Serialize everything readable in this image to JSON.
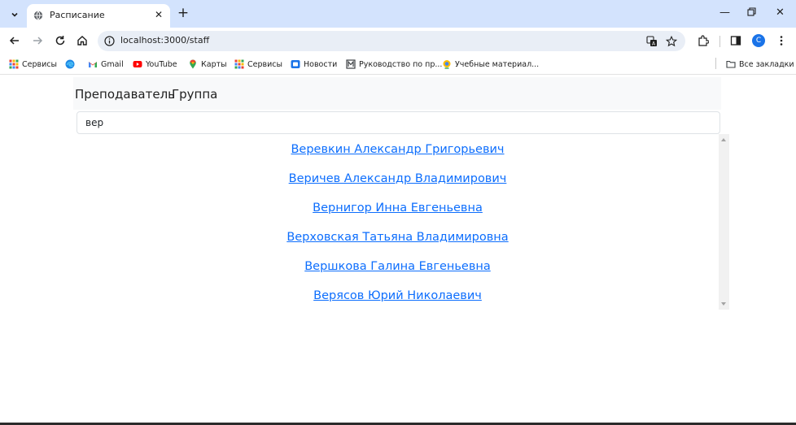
{
  "browser": {
    "tab_title": "Расписание",
    "url": "localhost:3000/staff",
    "profile_initial": "C"
  },
  "bookmarks": [
    {
      "label": "Сервисы",
      "icon": "apps-grid-icon"
    },
    {
      "label": "",
      "icon": "edge-icon"
    },
    {
      "label": "Gmail",
      "icon": "gmail-icon"
    },
    {
      "label": "YouTube",
      "icon": "youtube-icon"
    },
    {
      "label": "Карты",
      "icon": "maps-pin-icon"
    },
    {
      "label": "Сервисы",
      "icon": "apps-grid-icon"
    },
    {
      "label": "Новости",
      "icon": "news-icon"
    },
    {
      "label": "Руководство по пр...",
      "icon": "guide-icon"
    },
    {
      "label": "Учебные материал...",
      "icon": "materials-icon"
    }
  ],
  "all_bookmarks_label": "Все закладки",
  "page": {
    "nav": {
      "teacher": "Преподаватель",
      "group": "Группа"
    },
    "search": {
      "value": "вер",
      "placeholder": ""
    },
    "results": [
      "Веревкин Александр Григорьевич",
      "Веричев Александр Владимирович",
      "Вернигор Инна Евгеньевна",
      "Верховская Татьяна Владимировна",
      "Вершкова Галина Евгеньевна",
      "Верясов Юрий Николаевич"
    ],
    "link_color": "#0d6efd"
  }
}
